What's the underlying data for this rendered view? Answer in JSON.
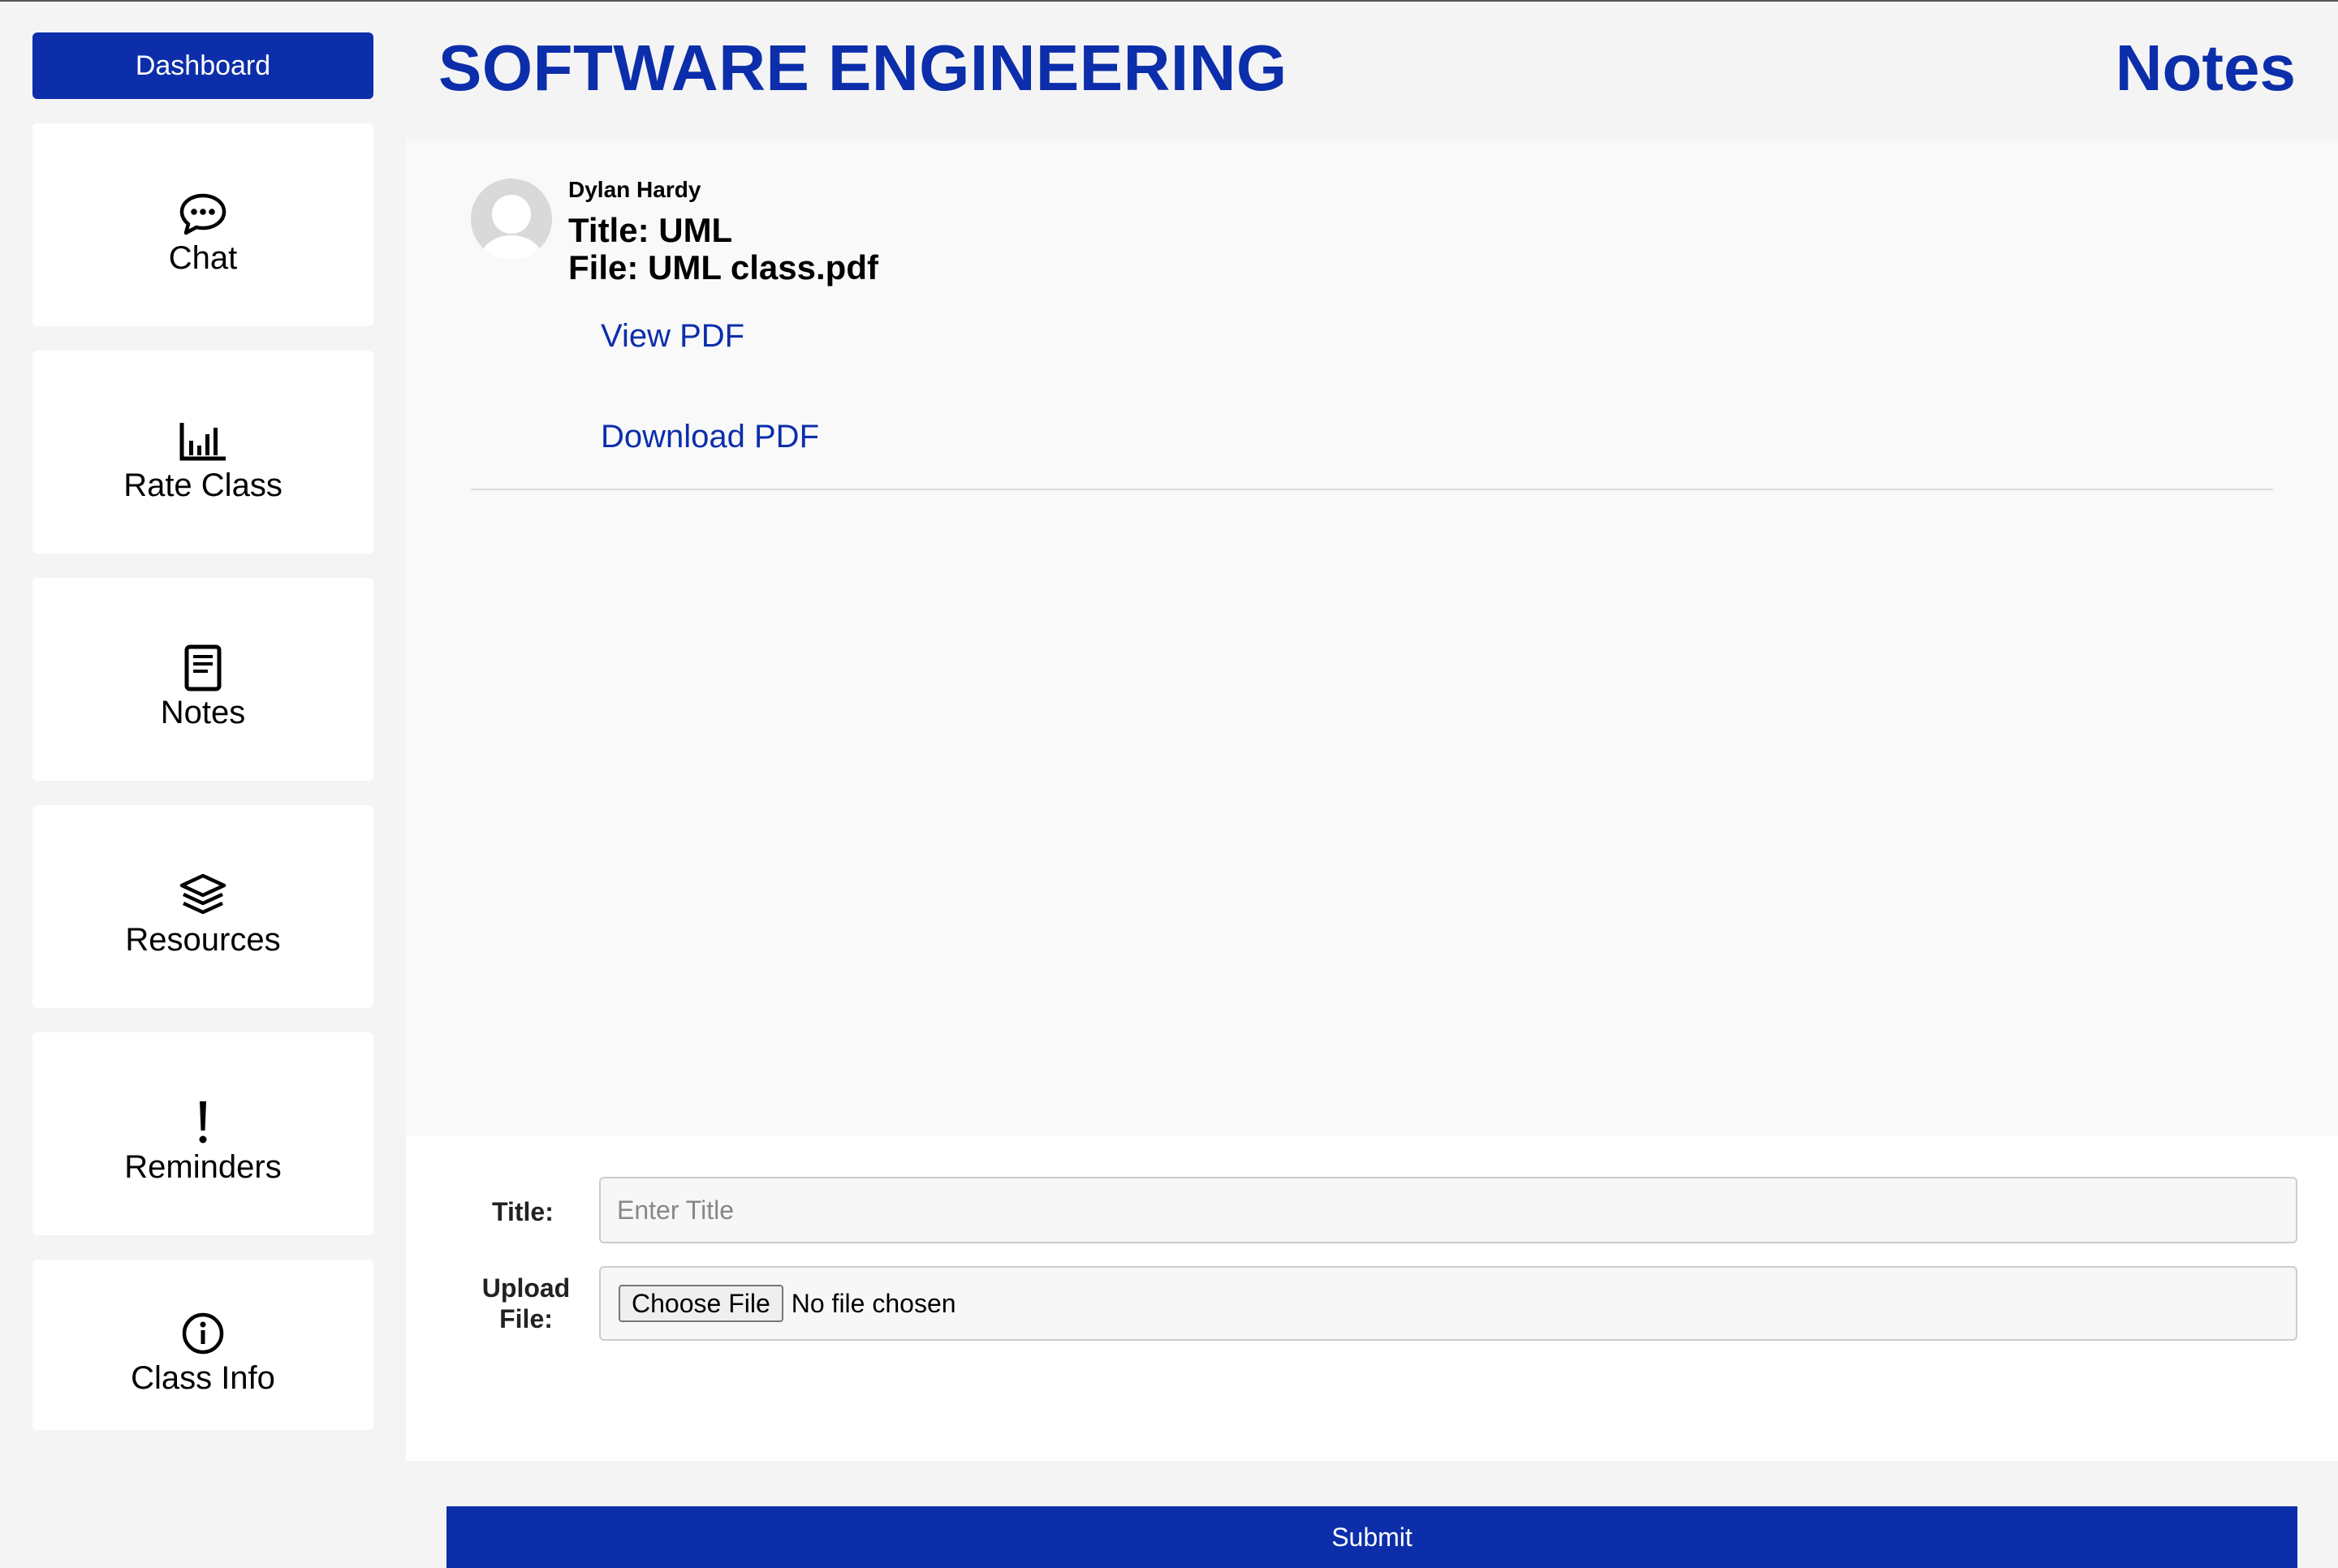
{
  "header": {
    "course_title": "SOFTWARE ENGINEERING",
    "page_title": "Notes"
  },
  "sidebar": {
    "dashboard_label": "Dashboard",
    "items": [
      {
        "label": "Chat",
        "icon": "chat-bubble-icon"
      },
      {
        "label": "Rate Class",
        "icon": "bar-chart-icon"
      },
      {
        "label": "Notes",
        "icon": "notebook-icon"
      },
      {
        "label": "Resources",
        "icon": "layers-icon"
      },
      {
        "label": "Reminders",
        "icon": "exclamation-icon"
      },
      {
        "label": "Class Info",
        "icon": "info-icon"
      }
    ]
  },
  "note": {
    "author": "Dylan Hardy",
    "title": "Title: UML",
    "file": "File: UML class.pdf",
    "view_link": "View PDF",
    "download_link": "Download PDF"
  },
  "form": {
    "title_label": "Title:",
    "title_placeholder": "Enter Title",
    "upload_label_line1": "Upload",
    "upload_label_line2": "File:",
    "choose_file_label": "Choose File",
    "no_file_text": "No file chosen",
    "submit_label": "Submit"
  },
  "colors": {
    "brand_blue": "#0c2eaa",
    "background": "#f4f4f4"
  }
}
